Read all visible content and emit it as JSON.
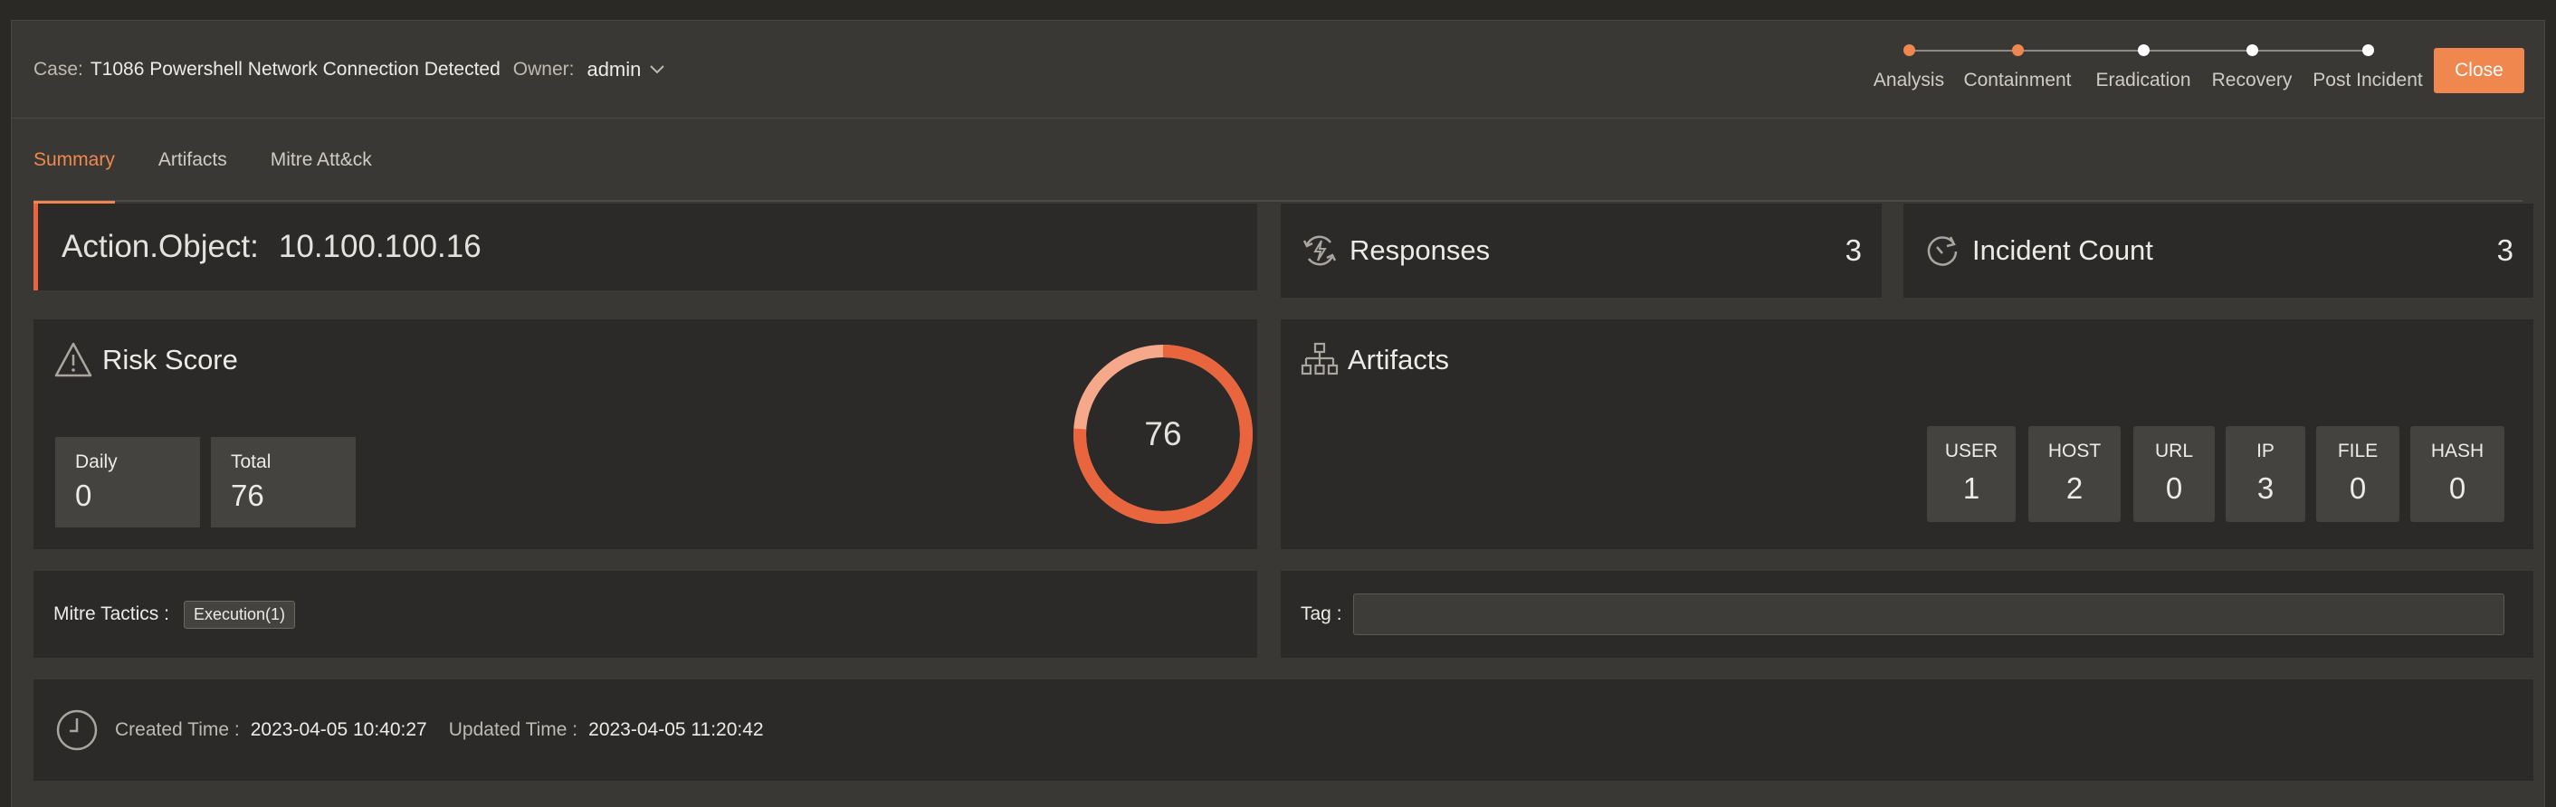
{
  "header": {
    "case_label": "Case:",
    "case_title": "T1086 Powershell Network Connection Detected",
    "owner_label": "Owner:",
    "owner_value": "admin",
    "close_label": "Close",
    "steps": [
      {
        "label": "Analysis",
        "active": true
      },
      {
        "label": "Containment",
        "active": true
      },
      {
        "label": "Eradication",
        "active": false
      },
      {
        "label": "Recovery",
        "active": false
      },
      {
        "label": "Post Incident",
        "active": false
      }
    ]
  },
  "tabs": [
    "Summary",
    "Artifacts",
    "Mitre Att&ck"
  ],
  "action": {
    "label": "Action.Object:",
    "value": "10.100.100.16"
  },
  "responses": {
    "title": "Responses",
    "count": "3"
  },
  "incident_count": {
    "title": "Incident Count",
    "count": "3"
  },
  "risk": {
    "title": "Risk Score",
    "daily_label": "Daily",
    "daily_value": "0",
    "total_label": "Total",
    "total_value": "76",
    "score": "76"
  },
  "artifacts": {
    "title": "Artifacts",
    "items": [
      {
        "label": "USER",
        "value": "1"
      },
      {
        "label": "HOST",
        "value": "2"
      },
      {
        "label": "URL",
        "value": "0"
      },
      {
        "label": "IP",
        "value": "3"
      },
      {
        "label": "FILE",
        "value": "0"
      },
      {
        "label": "HASH",
        "value": "0"
      }
    ]
  },
  "mitre": {
    "label": "Mitre Tactics :",
    "badge": "Execution(1)"
  },
  "tag": {
    "label": "Tag :",
    "value": ""
  },
  "times": {
    "created_label": "Created Time :",
    "created_value": "2023-04-05 10:40:27",
    "updated_label": "Updated Time :",
    "updated_value": "2023-04-05 11:20:42"
  },
  "colors": {
    "accent": "#f0874f",
    "donut_main": "#e8653e",
    "donut_light": "#f5a98a"
  }
}
